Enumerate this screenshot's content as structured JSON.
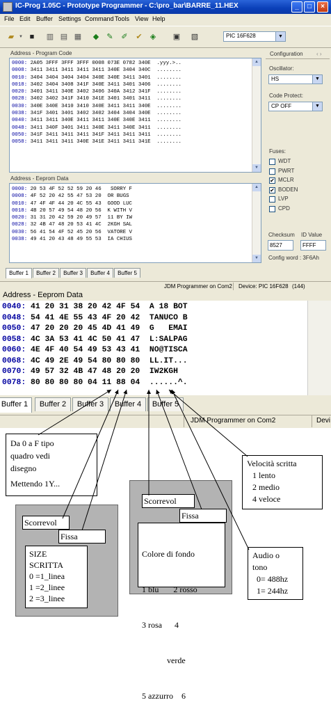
{
  "window": {
    "title": "IC-Prog 1.05C - Prototype Programmer - C:\\pro_bar\\BARRE_11.HEX",
    "min_glyph": "_",
    "max_glyph": "□",
    "close_glyph": "×"
  },
  "menu": [
    "File",
    "Edit",
    "Buffer",
    "Settings",
    "Command",
    "Tools",
    "View",
    "Help"
  ],
  "device": "PIC 16F628",
  "program_code": {
    "caption": "Address - Program Code",
    "rows": [
      {
        "addr": "0000:",
        "hex": "2A05 3FFF 3FFF 3FFF 0008 073E 0782 340E",
        "ascii": ".yyy.>.."
      },
      {
        "addr": "0008:",
        "hex": "3411 3411 3411 3411 3411 340E 3404 340C",
        "ascii": "........"
      },
      {
        "addr": "0010:",
        "hex": "3404 3404 3404 3404 340E 340E 3411 3401",
        "ascii": "........"
      },
      {
        "addr": "0018:",
        "hex": "3402 3404 3408 341F 340E 3411 3401 3406",
        "ascii": "........"
      },
      {
        "addr": "0020:",
        "hex": "3401 3411 340E 3402 3406 340A 3412 341F",
        "ascii": "........"
      },
      {
        "addr": "0028:",
        "hex": "3402 3402 341F 3410 341E 3401 3401 3411",
        "ascii": "........"
      },
      {
        "addr": "0030:",
        "hex": "340E 340E 3410 3410 340E 3411 3411 340E",
        "ascii": "........"
      },
      {
        "addr": "0038:",
        "hex": "341F 3401 3401 3402 3402 3404 3404 340E",
        "ascii": "........"
      },
      {
        "addr": "0040:",
        "hex": "3411 3411 340E 3411 3411 340E 340E 3411",
        "ascii": "........"
      },
      {
        "addr": "0048:",
        "hex": "3411 340F 3401 3411 340E 3411 340E 3411",
        "ascii": "........"
      },
      {
        "addr": "0050:",
        "hex": "341F 3411 3411 3411 341F 3411 3411 3411",
        "ascii": "........"
      },
      {
        "addr": "0058:",
        "hex": "3411 3411 3411 340E 341E 3411 3411 341E",
        "ascii": "........"
      }
    ]
  },
  "eeprom": {
    "caption": "Address - Eeprom Data",
    "rows": [
      {
        "addr": "0000:",
        "hex": "20 53 4F 52 52 59 20 46",
        "ascii": " SORRY F"
      },
      {
        "addr": "0008:",
        "hex": "4F 52 20 42 55 47 53 20",
        "ascii": "OR BUGS "
      },
      {
        "addr": "0010:",
        "hex": "47 4F 4F 44 20 4C 55 43",
        "ascii": "GOOD LUC"
      },
      {
        "addr": "0018:",
        "hex": "4B 20 57 49 54 48 20 56",
        "ascii": "K WITH V"
      },
      {
        "addr": "0020:",
        "hex": "31 31 20 42 59 20 49 57",
        "ascii": "11 BY IW"
      },
      {
        "addr": "0028:",
        "hex": "32 4B 47 48 20 53 41 4C",
        "ascii": "2KGH SAL"
      },
      {
        "addr": "0030:",
        "hex": "56 41 54 4F 52 45 20 56",
        "ascii": "VATORE V"
      },
      {
        "addr": "0038:",
        "hex": "49 41 20 43 48 49 55 53",
        "ascii": "IA CHIUS"
      }
    ]
  },
  "config": {
    "title": "Configuration",
    "oscillator_label": "Oscillator:",
    "oscillator": "HS",
    "code_protect_label": "Code Protect:",
    "code_protect": "CP OFF",
    "fuses_label": "Fuses:",
    "fuses": [
      {
        "name": "WDT",
        "checked": false
      },
      {
        "name": "PWRT",
        "checked": false
      },
      {
        "name": "MCLR",
        "checked": true
      },
      {
        "name": "BODEN",
        "checked": true
      },
      {
        "name": "LVP",
        "checked": false
      },
      {
        "name": "CPD",
        "checked": false
      }
    ],
    "checksum_label": "Checksum",
    "checksum": "8527",
    "id_label": "ID Value",
    "id_value": "FFFF",
    "config_word": "Config word : 3F6Ah"
  },
  "tabs": [
    "Buffer 1",
    "Buffer 2",
    "Buffer 3",
    "Buffer 4",
    "Buffer 5"
  ],
  "status": {
    "programmer": "JDM Programmer on Com2",
    "device": "Device: PIC 16F628",
    "count": "(144)"
  },
  "zoom": {
    "caption": "Address - Eeprom Data",
    "rows": [
      {
        "addr": "0040:",
        "hex": "41 20 31 38 20 42 4F 54",
        "ascii": "A 18 BOT"
      },
      {
        "addr": "0048:",
        "hex": "54 41 4E 55 43 4F 20 42",
        "ascii": "TANUCO B"
      },
      {
        "addr": "0050:",
        "hex": "47 20 20 20 45 4D 41 49",
        "ascii": "G   EMAI"
      },
      {
        "addr": "0058:",
        "hex": "4C 3A 53 41 4C 50 41 47",
        "ascii": "L:SALPAG"
      },
      {
        "addr": "0060:",
        "hex": "4E 4F 40 54 49 53 43 41",
        "ascii": "NO@TISCA"
      },
      {
        "addr": "0068:",
        "hex": "4C 49 2E 49 54 80 80 80",
        "ascii": "LL.IT..."
      },
      {
        "addr": "0070:",
        "hex": "49 57 32 4B 47 48 20 20",
        "ascii": "IW2KGH  "
      },
      {
        "addr": "0078:",
        "hex": "80 80 80 80 04 11 88 04",
        "ascii": "......^."
      }
    ],
    "tabs": [
      "Buffer 1",
      "Buffer 2",
      "Buffer 3",
      "Buffer 4",
      "Buffer 5"
    ],
    "status_programmer": "JDM Programmer on Com2",
    "status_device": "Devi"
  },
  "annotations": {
    "tipo_quadro": [
      "Da 0 a  F tipo",
      "quadro vedi",
      "disegno",
      "Mettendo 1Y..."
    ],
    "velocita": [
      "Velocità scritta",
      "1  lento",
      "2  medio",
      "4  veloce"
    ],
    "scorrevol_1": "Scorrevol",
    "fissa_1": "Fissa",
    "size": [
      "SIZE",
      "SCRITTA",
      "0 =1_linea",
      "1 =2_linee",
      "2 =3_linee"
    ],
    "scorrevol_2": "Scorrevol",
    "fissa_2": "Fissa",
    "colore": [
      "Colore di fondo",
      "1 blu       2 rosso",
      "3 rosa      4",
      "            verde",
      "5 azzurro    6"
    ],
    "audio": [
      "Audio o",
      "tono",
      "0= 488hz",
      "1= 244hz"
    ]
  }
}
